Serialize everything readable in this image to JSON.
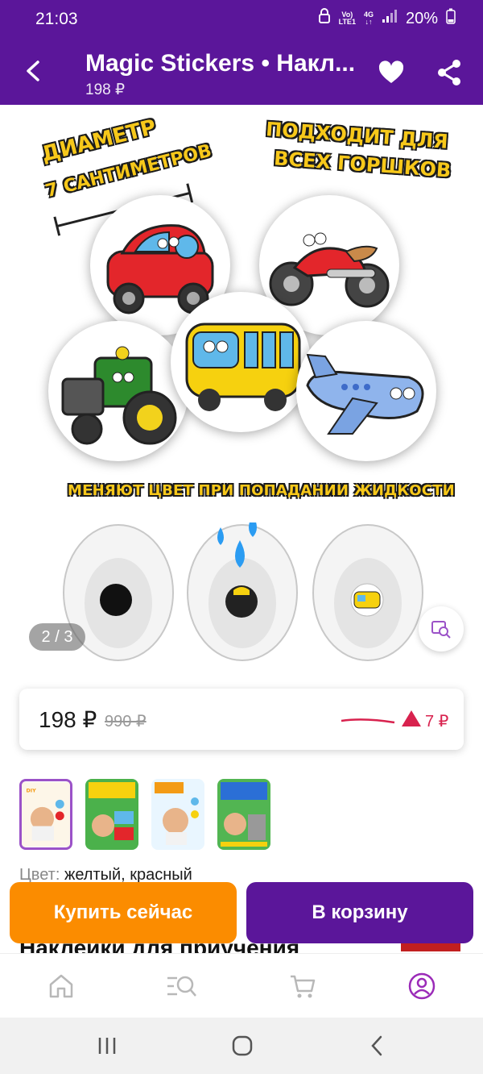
{
  "status_bar": {
    "time": "21:03",
    "signal_top": "Vo)",
    "signal_bottom": "LTE1",
    "net_top": "4G",
    "net_bottom": "↓↑",
    "battery": "20%"
  },
  "app_bar": {
    "title": "Magic Stickers • Накл...",
    "subtitle": "198 ₽",
    "back_icon": "back-arrow-icon",
    "favorite_icon": "heart-icon",
    "share_icon": "share-icon",
    "background_color": "#5b169a"
  },
  "gallery": {
    "banner_line1": "Диаметр",
    "banner_line2": "7 сантиметров",
    "banner_right_line1": "Подходит для",
    "banner_right_line2": "всех горшков",
    "banner_bottom": "Меняют цвет при попадании жидкости",
    "page_indicator": "2 / 3",
    "visual_search_icon": "image-search-icon"
  },
  "price_card": {
    "price": "198 ₽",
    "old_price": "990 ₽",
    "trend_value": "7 ₽",
    "trend_color": "#d8224e"
  },
  "thumbnails": [
    {
      "active": true
    },
    {
      "active": false
    },
    {
      "active": false
    },
    {
      "active": false
    }
  ],
  "product": {
    "color_label": "Цвет:",
    "color_value": "желтый, красный",
    "heading": "Наклейки для приучения"
  },
  "actions": {
    "buy_now_label": "Купить сейчас",
    "add_to_cart_label": "В корзину",
    "buy_color": "#fb8c00",
    "cart_color": "#5b169a"
  },
  "bottom_nav": [
    {
      "icon": "home-icon"
    },
    {
      "icon": "catalog-search-icon"
    },
    {
      "icon": "cart-icon"
    },
    {
      "icon": "profile-icon",
      "active": true
    }
  ],
  "system_nav": [
    {
      "icon": "recent-apps-icon"
    },
    {
      "icon": "home-circle-icon"
    },
    {
      "icon": "system-back-icon"
    }
  ]
}
